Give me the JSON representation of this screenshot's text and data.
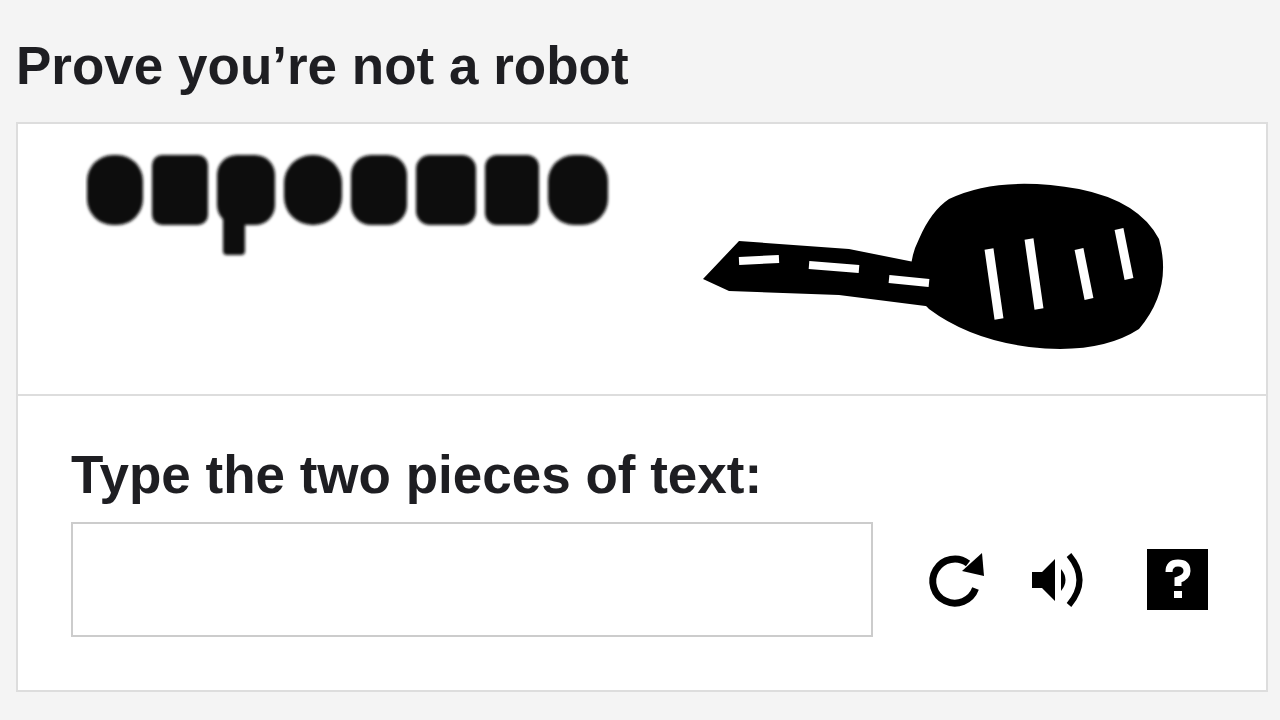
{
  "title": "Prove you’re not a robot",
  "answer": {
    "label": "Type the two pieces of text:"
  }
}
